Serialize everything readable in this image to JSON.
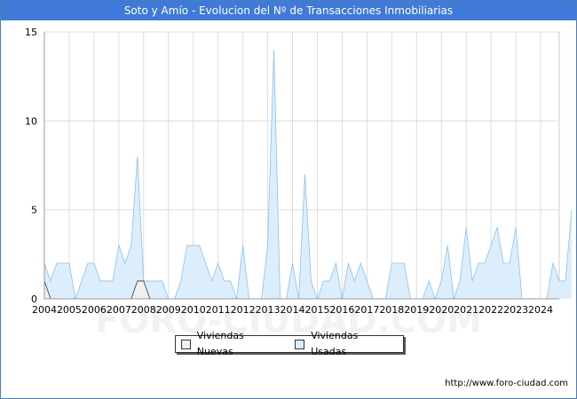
{
  "header": {
    "title": "Soto y Amío - Evolucion del Nº de Transacciones Inmobiliarias"
  },
  "watermark": "FORO-CIUDAD.COM",
  "source": "http://www.foro-ciudad.com",
  "colors": {
    "title_bg": "#3f7ad9",
    "nuevas_fill": "#f0f0f0",
    "nuevas_line": "#333333",
    "usadas_fill": "#dceefc",
    "usadas_line": "#8cc0ea",
    "grid": "#dddddd"
  },
  "chart_data": {
    "type": "area",
    "title": "Soto y Amío - Evolucion del Nº de Transacciones Inmobiliarias",
    "xlabel": "",
    "ylabel": "",
    "ylim": [
      0,
      15
    ],
    "yticks": [
      0,
      5,
      10,
      15
    ],
    "xlim": [
      2004,
      2024.75
    ],
    "xticks": [
      "2004",
      "2005",
      "2006",
      "2007",
      "2008",
      "2009",
      "2010",
      "2011",
      "2012",
      "2013",
      "2014",
      "2015",
      "2016",
      "2017",
      "2018",
      "2019",
      "2020",
      "2021",
      "2022",
      "2023",
      "2024"
    ],
    "grid": true,
    "legend_position": "bottom",
    "x_start": 2004,
    "x_step": 0.25,
    "series": [
      {
        "name": "Viviendas Nuevas",
        "values": [
          1,
          0,
          0,
          0,
          0,
          0,
          0,
          0,
          0,
          0,
          0,
          0,
          0,
          0,
          0,
          1,
          1,
          0,
          0,
          0,
          0,
          0,
          0,
          0,
          0,
          0,
          0,
          0,
          0,
          0,
          0,
          0,
          0,
          0,
          0,
          0,
          0,
          0,
          0,
          0,
          0,
          0,
          0,
          0,
          0,
          0,
          0,
          0,
          0,
          0,
          0,
          0,
          0,
          0,
          0,
          0,
          0,
          0,
          0,
          0,
          0,
          0,
          0,
          0,
          0,
          0,
          0,
          0,
          0,
          0,
          0,
          0,
          0,
          0,
          0,
          0,
          0,
          0,
          0,
          0,
          0,
          0,
          0
        ]
      },
      {
        "name": "Viviendas Usadas",
        "values": [
          2,
          1,
          2,
          2,
          2,
          0,
          1,
          2,
          2,
          1,
          1,
          1,
          3,
          2,
          3,
          8,
          1,
          1,
          1,
          1,
          0,
          0,
          1,
          3,
          3,
          3,
          2,
          1,
          2,
          1,
          1,
          0,
          3,
          0,
          0,
          0,
          3,
          14,
          0,
          0,
          2,
          0,
          7,
          1,
          0,
          1,
          1,
          2,
          0,
          2,
          1,
          2,
          1,
          0,
          0,
          0,
          2,
          2,
          2,
          0,
          0,
          0,
          1,
          0,
          1,
          3,
          0,
          1,
          4,
          1,
          2,
          2,
          3,
          4,
          2,
          2,
          4,
          0,
          0,
          0,
          0,
          0,
          2,
          1,
          1,
          5
        ]
      }
    ]
  }
}
